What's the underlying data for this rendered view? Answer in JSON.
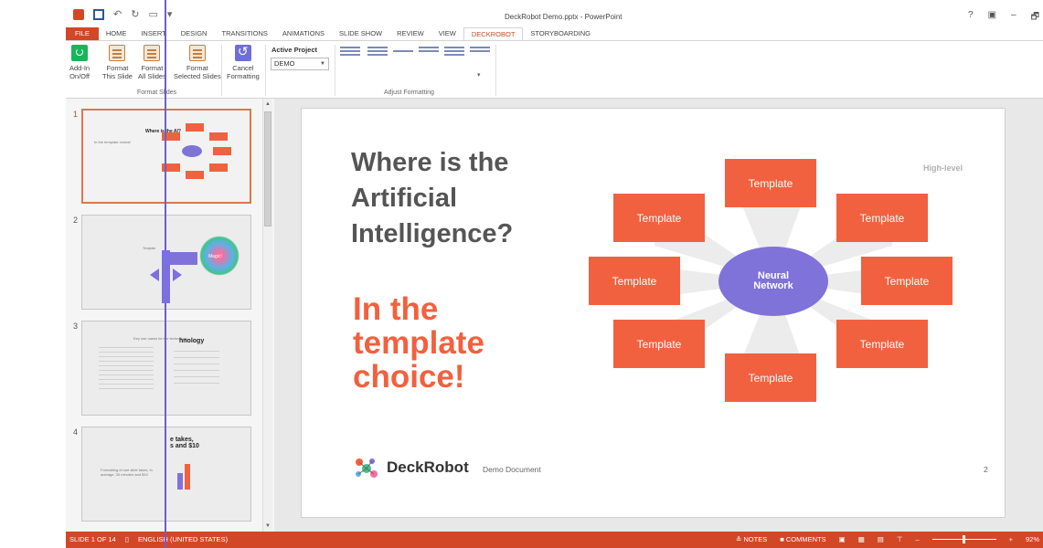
{
  "window": {
    "title": "DeckRobot Demo.pptx - PowerPoint",
    "controls": [
      "?",
      "▣",
      "–",
      "🗗"
    ]
  },
  "tabs": [
    {
      "label": "FILE"
    },
    {
      "label": "HOME"
    },
    {
      "label": "INSERT"
    },
    {
      "label": "DESIGN"
    },
    {
      "label": "TRANSITIONS"
    },
    {
      "label": "ANIMATIONS"
    },
    {
      "label": "SLIDE SHOW"
    },
    {
      "label": "REVIEW"
    },
    {
      "label": "VIEW"
    },
    {
      "label": "DECKROBOT"
    },
    {
      "label": "STORYBOARDING"
    }
  ],
  "ribbon": {
    "addin": "Add-In\nOn/Off",
    "format_this": "Format\nThis Slide",
    "format_all": "Format\nAll Slides",
    "format_selected": "Format\nSelected Slides",
    "cancel": "Cancel\nFormatting",
    "group_format": "Format Slides",
    "active_project_label": "Active Project",
    "active_project_value": "DEMO",
    "group_adjust": "Adjust Formatting"
  },
  "thumbnails": [
    {
      "num": "1",
      "title": "Where is the AI?",
      "text1": "In the template choice!",
      "ellipse": "Neural Network"
    },
    {
      "num": "2",
      "title": "",
      "text1": "Template",
      "text2": "Magic!"
    },
    {
      "num": "3",
      "title": "hnology",
      "text1": "Key use cases for the technology"
    },
    {
      "num": "4",
      "title": "e takes,\ns and $10",
      "text1": "Formatting of one slide takes, in average, 30 minutes and $10"
    }
  ],
  "slide": {
    "title": "Where is the\nArtificial\nIntelligence?",
    "subtitle": "In the\ntemplate\nchoice!",
    "high_level": "High-level",
    "center": "Neural\nNetwork",
    "boxes": [
      "Template",
      "Template",
      "Template",
      "Template",
      "Template",
      "Template",
      "Template",
      "Template"
    ],
    "logo_text": "DeckRobot",
    "footer_doc": "Demo Document",
    "page": "2"
  },
  "status": {
    "slide_count": "SLIDE 1 OF 14",
    "language": "ENGLISH (UNITED STATES)",
    "notes": "≙ NOTES",
    "comments": "COMMENTS",
    "zoom": "92%"
  },
  "colors": {
    "accent": "#d24726",
    "template_box": "#f1613f",
    "ellipse": "#7f73d9"
  }
}
